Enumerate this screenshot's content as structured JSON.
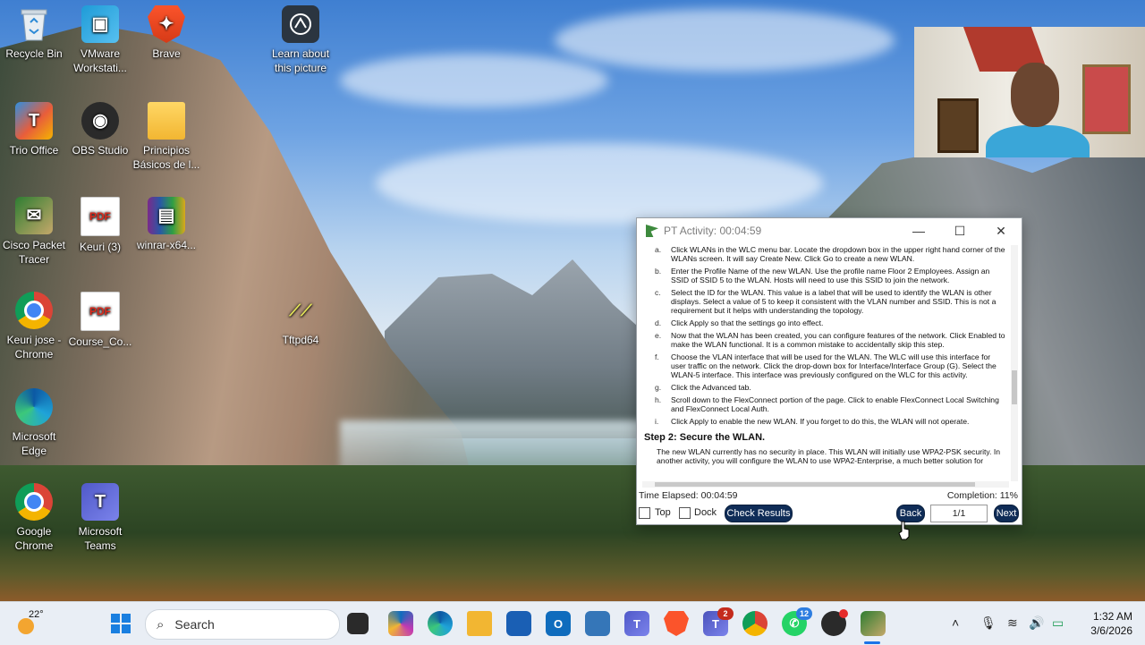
{
  "desktop": {
    "icons": [
      {
        "label": "Recycle Bin"
      },
      {
        "label": "VMware Workstati..."
      },
      {
        "label": "Brave"
      },
      {
        "label": "Learn about this picture"
      },
      {
        "label": "Trio Office"
      },
      {
        "label": "OBS Studio"
      },
      {
        "label": "Principios Básicos de l..."
      },
      {
        "label": "Cisco Packet Tracer"
      },
      {
        "label": "Keuri (3)"
      },
      {
        "label": "winrar-x64..."
      },
      {
        "label": "Keuri jose - Chrome"
      },
      {
        "label": "Course_Co..."
      },
      {
        "label": "Tftpd64"
      },
      {
        "label": "Microsoft Edge"
      },
      {
        "label": "Google Chrome"
      },
      {
        "label": "Microsoft Teams"
      }
    ],
    "pdf_badge": "PDF"
  },
  "pt_window": {
    "title": "PT Activity: 00:04:59",
    "steps": [
      {
        "letter": "a.",
        "text": "Click WLANs in the WLC menu bar. Locate the dropdown box in the upper right hand corner of the WLANs screen. It will say Create New. Click Go to create a new WLAN."
      },
      {
        "letter": "b.",
        "text": "Enter the Profile Name of the new WLAN. Use the profile name Floor 2 Employees. Assign an SSID of SSID 5 to the WLAN. Hosts will need to use this SSID to join the network."
      },
      {
        "letter": "c.",
        "text": "Select the ID for the WLAN. This value is a label that will be used to identify the WLAN is other displays. Select a value of 5 to keep it consistent with the VLAN number and SSID. This is not a requirement but it helps with understanding the topology."
      },
      {
        "letter": "d.",
        "text": "Click Apply so that the settings go into effect."
      },
      {
        "letter": "e.",
        "text": "Now that the WLAN has been created, you can configure features of the network. Click Enabled to make the WLAN functional. It is a common mistake to accidentally skip this step."
      },
      {
        "letter": "f.",
        "text": "Choose the VLAN interface that will be used for the WLAN. The WLC will use this interface for user traffic on the network. Click the drop-down box for Interface/Interface Group (G). Select the WLAN-5 interface. This interface was previously configured on the WLC for this activity."
      },
      {
        "letter": "g.",
        "text": "Click the Advanced tab."
      },
      {
        "letter": "h.",
        "text": "Scroll down to the FlexConnect portion of the page. Click to enable FlexConnect Local Switching and FlexConnect Local Auth."
      },
      {
        "letter": "i.",
        "text": "Click Apply to enable the new WLAN. If you forget to do this, the WLAN will not operate."
      }
    ],
    "step2_heading": "Step 2: Secure the WLAN.",
    "step2_text": "The new WLAN currently has no security in place. This WLAN will initially use WPA2-PSK security. In another activity, you will configure the WLAN to use WPA2-Enterprise, a much better solution for",
    "time_elapsed": "Time Elapsed: 00:04:59",
    "completion": "Completion: 11%",
    "top_label": "Top",
    "dock_label": "Dock",
    "check_results_label": "Check Results",
    "back_label": "Back",
    "page_indicator": "1/1",
    "next_label": "Next"
  },
  "taskbar": {
    "weather_temp": "22°",
    "search_placeholder": "Search",
    "teams_badge": "2",
    "whatsapp_badge": "12",
    "time": "1:32 AM",
    "date": "3/6/2026"
  }
}
